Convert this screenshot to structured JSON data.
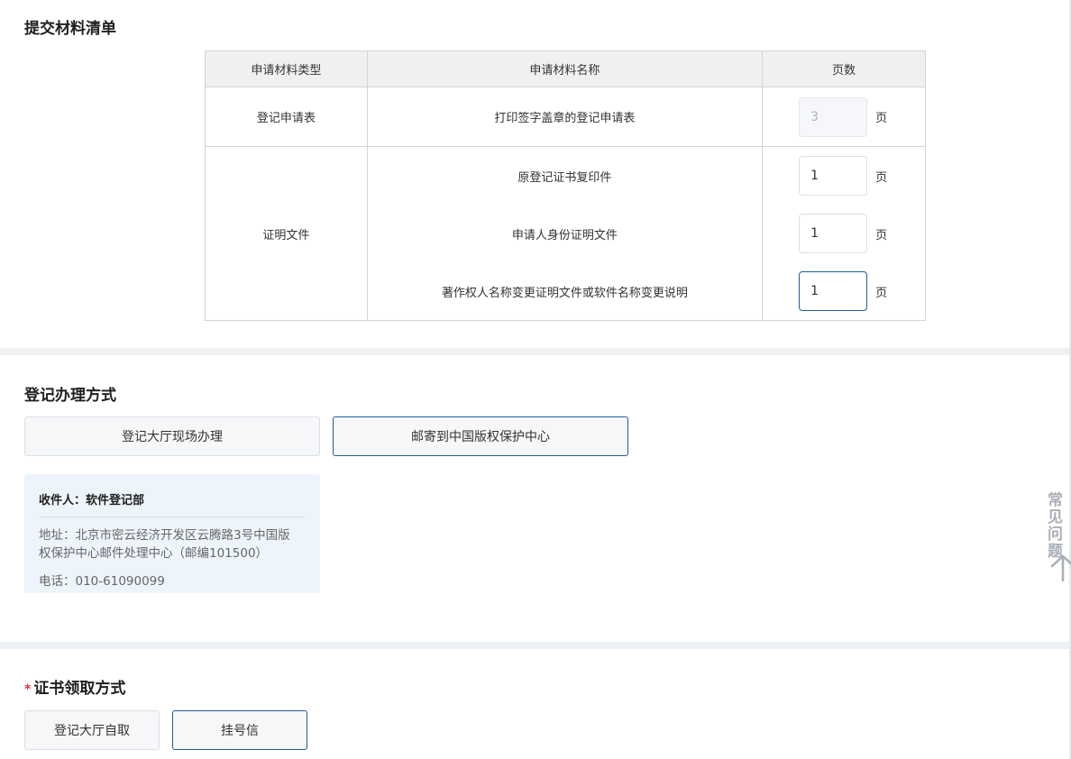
{
  "materials": {
    "title": "提交材料清单",
    "headers": {
      "type": "申请材料类型",
      "name": "申请材料名称",
      "pages": "页数"
    },
    "unit": "页",
    "groups": [
      {
        "type": "登记申请表",
        "items": [
          {
            "name": "打印签字盖章的登记申请表",
            "pages": "3",
            "disabled": true
          }
        ]
      },
      {
        "type": "证明文件",
        "items": [
          {
            "name": "原登记证书复印件",
            "pages": "1"
          },
          {
            "name": "申请人身份证明文件",
            "pages": "1"
          },
          {
            "name": "著作权人名称变更证明文件或软件名称变更说明",
            "pages": "1",
            "focused": true
          }
        ]
      }
    ]
  },
  "registration": {
    "title": "登记办理方式",
    "options": [
      {
        "label": "登记大厅现场办理",
        "selected": false
      },
      {
        "label": "邮寄到中国版权保护中心",
        "selected": true
      }
    ],
    "address": {
      "recipient": "收件人：软件登记部",
      "address_line1": "地址：北京市密云经济开发区云腾路3号中国版",
      "address_line2": "权保护中心邮件处理中心（邮编101500）",
      "phone": "电话：010-61090099"
    }
  },
  "certificate": {
    "required_mark": "*",
    "title": "证书领取方式",
    "options": [
      {
        "label": "登记大厅自取",
        "selected": false
      },
      {
        "label": "挂号信",
        "selected": true
      }
    ]
  },
  "floating": {
    "help_line1": "常见",
    "help_line2": "问题",
    "help_icon": "question-icon",
    "up_icon": "arrow-up-icon"
  },
  "colors": {
    "accent_border": "#1e5d99",
    "required": "#e23232",
    "card_bg": "#eef4fb",
    "divider": "#eff2f5"
  }
}
